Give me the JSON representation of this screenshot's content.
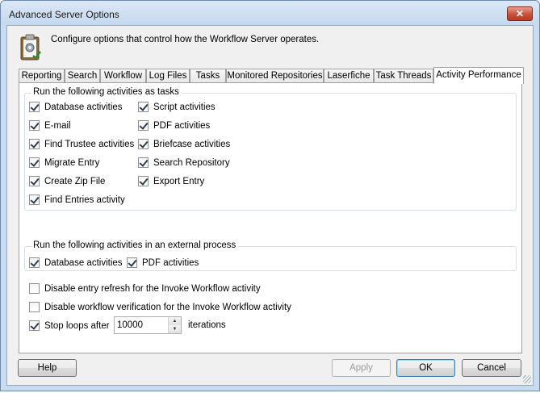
{
  "window": {
    "title": "Advanced Server Options",
    "close_glyph": "✕"
  },
  "header": {
    "description": "Configure options that control how the Workflow Server operates.",
    "icon": "settings-clipboard-icon"
  },
  "tabs": [
    {
      "label": "Reporting"
    },
    {
      "label": "Search"
    },
    {
      "label": "Workflow"
    },
    {
      "label": "Log Files"
    },
    {
      "label": "Tasks"
    },
    {
      "label": "Monitored Repositories"
    },
    {
      "label": "Laserfiche"
    },
    {
      "label": "Task Threads"
    },
    {
      "label": "Activity Performance",
      "active": true
    }
  ],
  "tasks_group": {
    "legend": "Run the following activities as tasks",
    "left": [
      {
        "label": "Database activities",
        "checked": true
      },
      {
        "label": "E-mail",
        "checked": true
      },
      {
        "label": "Find Trustee activities",
        "checked": true
      },
      {
        "label": "Migrate Entry",
        "checked": true
      },
      {
        "label": "Create Zip File",
        "checked": true
      },
      {
        "label": "Find Entries activity",
        "checked": true
      }
    ],
    "right": [
      {
        "label": "Script activities",
        "checked": true
      },
      {
        "label": "PDF activities",
        "checked": true
      },
      {
        "label": "Briefcase activities",
        "checked": true
      },
      {
        "label": "Search Repository",
        "checked": true
      },
      {
        "label": "Export Entry",
        "checked": true
      }
    ]
  },
  "external_group": {
    "legend": "Run the following activities in an external process",
    "items": [
      {
        "label": "Database activities",
        "checked": true
      },
      {
        "label": "PDF activities",
        "checked": true
      }
    ]
  },
  "options": {
    "disable_refresh": {
      "label": "Disable entry refresh for the Invoke Workflow activity",
      "checked": false
    },
    "disable_verification": {
      "label": "Disable workflow verification for the Invoke Workflow activity",
      "checked": false
    },
    "stop_loops": {
      "label": "Stop loops after",
      "checked": true,
      "value": "10000",
      "suffix": "iterations"
    }
  },
  "buttons": {
    "help": "Help",
    "apply": "Apply",
    "ok": "OK",
    "cancel": "Cancel"
  }
}
